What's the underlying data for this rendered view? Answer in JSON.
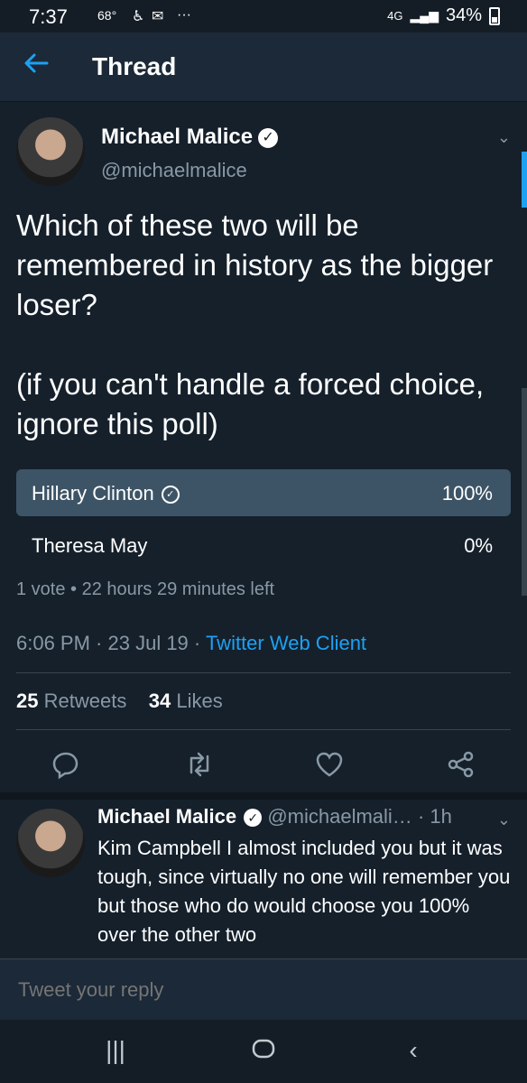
{
  "status_bar": {
    "time": "7:37",
    "temp": "68°",
    "battery": "34%",
    "network": "4G"
  },
  "header": {
    "title": "Thread"
  },
  "tweet": {
    "author": "Michael Malice",
    "handle": "@michaelmalice",
    "text": "Which of these two will be remembered in history as the bigger loser?\n\n(if you can't handle a forced choice, ignore this poll)",
    "poll": {
      "options": [
        {
          "label": "Hillary Clinton",
          "percent": "100%",
          "fraction": 1.0,
          "selected": true
        },
        {
          "label": "Theresa May",
          "percent": "0%",
          "fraction": 0.0,
          "selected": false
        }
      ],
      "meta": "1 vote • 22 hours 29 minutes left"
    },
    "time": "6:06 PM",
    "date": "23 Jul 19",
    "client": "Twitter Web Client",
    "retweets": "25",
    "retweets_label": "Retweets",
    "likes": "34",
    "likes_label": "Likes"
  },
  "reply": {
    "author": "Michael Malice",
    "handle": "@michaelmali…",
    "time": "1h",
    "text": "Kim Campbell I almost included you but it was tough, since virtually no one will remember you but those who do would choose you 100% over the other two"
  },
  "compose": {
    "placeholder": "Tweet your reply"
  },
  "icons": {
    "back": "back-arrow-icon",
    "reply": "reply-icon",
    "retweet": "retweet-icon",
    "like": "heart-icon",
    "share": "share-icon"
  },
  "colors": {
    "background": "#15202b",
    "accent": "#1da1f2",
    "muted": "#8899a6",
    "poll_fill": "#3d5466"
  }
}
